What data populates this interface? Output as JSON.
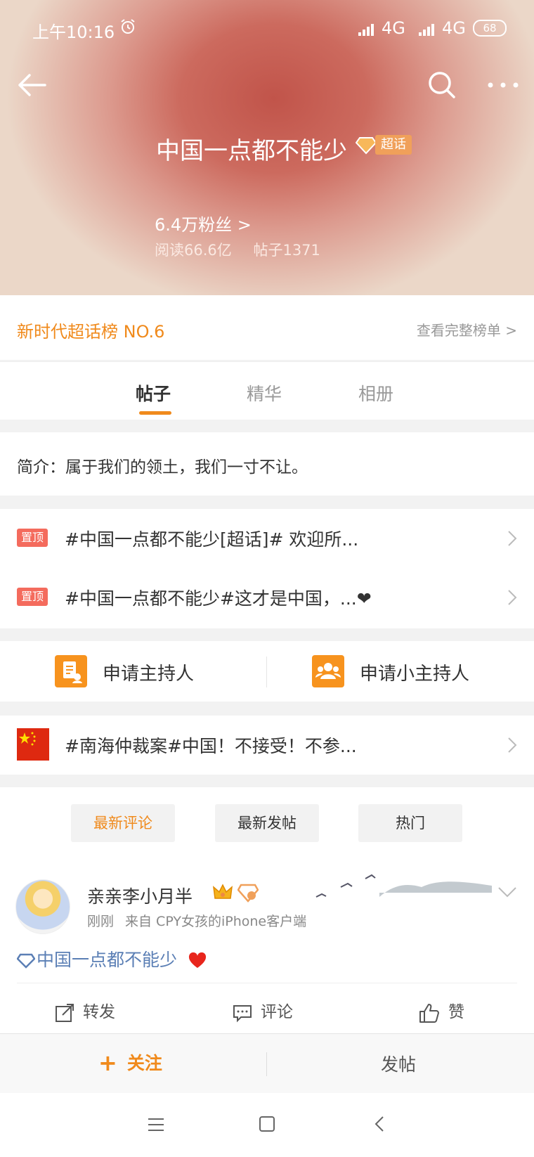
{
  "status_bar": {
    "time": "上午10:16",
    "network1": "4G",
    "network2": "4G",
    "battery": "68"
  },
  "header": {
    "title": "中国一点都不能少",
    "badge": "超话",
    "fans": "6.4万粉丝 >",
    "reads": "阅读66.6亿",
    "posts_count": "帖子1371"
  },
  "rank": {
    "label": "新时代超话榜 NO.6",
    "link": "查看完整榜单 >"
  },
  "tabs": [
    {
      "label": "帖子"
    },
    {
      "label": "精华"
    },
    {
      "label": "相册"
    }
  ],
  "intro": "简介：属于我们的领土，我们一寸不让。",
  "pinned": [
    {
      "badge": "置顶",
      "text": "#中国一点都不能少[超话]# 欢迎所..."
    },
    {
      "badge": "置顶",
      "text": "#中国一点都不能少#这才是中国，...❤"
    }
  ],
  "hosts": {
    "apply_host": "申请主持人",
    "apply_sub_host": "申请小主持人"
  },
  "news": {
    "text": "#南海仲裁案#中国！不接受！不参..."
  },
  "filters": [
    {
      "label": "最新评论"
    },
    {
      "label": "最新发帖"
    },
    {
      "label": "热门"
    }
  ],
  "post": {
    "username": "亲亲李小月半",
    "time": "刚刚",
    "source": "来自 CPY女孩的iPhone客户端",
    "topic": "中国一点都不能少",
    "actions": {
      "repost": "转发",
      "comment": "评论",
      "like": "赞"
    }
  },
  "bottom_bar": {
    "follow": "关注",
    "post": "发帖"
  },
  "colors": {
    "accent": "#f08a1c",
    "pin": "#f46b5d",
    "link": "#5b7fb5"
  }
}
